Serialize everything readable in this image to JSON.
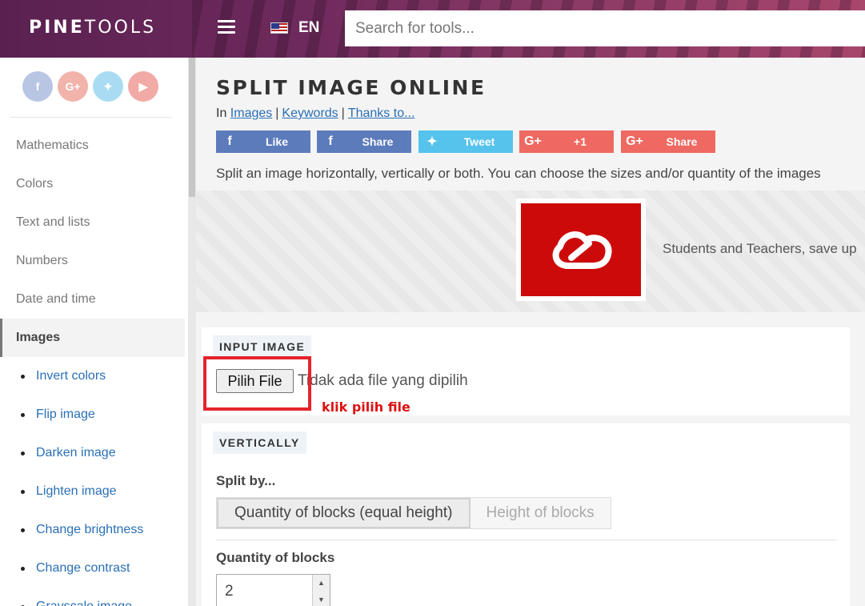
{
  "header": {
    "logo_bold": "PINE",
    "logo_light": "TOOLS",
    "language": "EN",
    "search_placeholder": "Search for tools..."
  },
  "sidebar": {
    "categories": [
      "Mathematics",
      "Colors",
      "Text and lists",
      "Numbers",
      "Date and time",
      "Images"
    ],
    "subitems": [
      "Invert colors",
      "Flip image",
      "Darken image",
      "Lighten image",
      "Change brightness",
      "Change contrast",
      "Grayscale image"
    ]
  },
  "page": {
    "title": "SPLIT IMAGE ONLINE",
    "crumb_prefix": "In",
    "crumbs": [
      "Images",
      "Keywords",
      "Thanks to..."
    ],
    "share_buttons": [
      "Like",
      "Share",
      "Tweet",
      "+1",
      "Share"
    ],
    "description": "Split an image horizontally, vertically or both. You can choose the sizes and/or quantity of the images",
    "ad_text": "Students and Teachers, save up"
  },
  "input_image": {
    "tag": "INPUT IMAGE",
    "button_label": "Pilih File",
    "no_file_text": "Tidak ada file yang dipilih",
    "annotation": "klik pilih file"
  },
  "vertically": {
    "tag": "VERTICALLY",
    "split_by_label": "Split by...",
    "options": [
      "Quantity of blocks (equal height)",
      "Height of blocks"
    ],
    "selected_option": "Quantity of blocks (equal height)",
    "quantity_label": "Quantity of blocks",
    "quantity_value": "2"
  },
  "colors": {
    "accent_link": "#2a6fb5",
    "annotation_red": "#e3242b",
    "facebook": "#4267b2",
    "twitter": "#55c3ec",
    "google_plus": "#ee5a52"
  }
}
